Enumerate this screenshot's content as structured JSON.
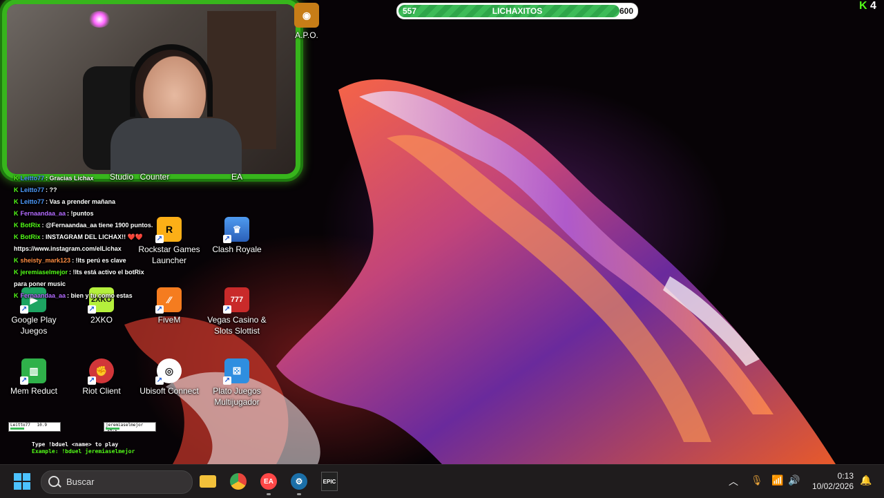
{
  "stream_overlay": {
    "subscriber_goal": {
      "current": "557",
      "label": "LICHAXITOS",
      "target": "600",
      "progress": 0.93
    },
    "viewer_badge": "4",
    "chat": [
      {
        "user": "Leitto77",
        "message": ": Gracias Lichax",
        "user_color": "#4e9bff"
      },
      {
        "user": "Leitto77",
        "message": ": ??",
        "user_color": "#4e9bff"
      },
      {
        "user": "Leitto77",
        "message": ": Vas a prender mañana",
        "user_color": "#4e9bff"
      },
      {
        "user": "Fernaandaa_aa",
        "message": ": !puntos",
        "user_color": "#b46bff"
      },
      {
        "user": "BotRix",
        "message": ": @Fernaandaa_aa tiene 1900 puntos.",
        "user_color": "#53fc18"
      },
      {
        "user": "BotRix",
        "message": ": INSTAGRAM DEL LICHAX!! ❤️❤️ https://www.instagram.com/elLichax",
        "user_color": "#53fc18"
      },
      {
        "user": "sheisty_mark123",
        "message": ": !lts perú es clave",
        "user_color": "#ff8c42"
      },
      {
        "user": "jeremiaselmejor",
        "message": ": !lts está activo el botRix para poner music",
        "user_color": "#53fc18"
      },
      {
        "user": "Fernaandaa_aa",
        "message": ": bien y tu como estas",
        "user_color": "#b46bff"
      }
    ],
    "duel_cards": [
      {
        "name": "Leitto77",
        "value": "10.9"
      },
      {
        "name": "jeremiaselmejor",
        "value": "14.1"
      }
    ],
    "duel_help": [
      "Type !bduel <name> to play",
      "Example: !bduel jeremiaselmejor"
    ]
  },
  "desktop_icons": [
    {
      "label": "A.P.O.",
      "icon": "app-icon",
      "color": "#c77d17"
    },
    {
      "label": "Studio",
      "icon": "studio-icon",
      "color": "#333"
    },
    {
      "label": "Counter",
      "icon": "counter-strike-icon",
      "color": "#333"
    },
    {
      "label": "EA",
      "icon": "ea-icon",
      "color": "#ff4747"
    },
    {
      "label": "Rockstar Games Launcher",
      "icon": "rockstar-icon",
      "color": "#fcaf17"
    },
    {
      "label": "Clash Royale",
      "icon": "clash-royale-icon",
      "color": "#3b7ddd"
    },
    {
      "label": "Google Play Juegos",
      "icon": "google-play-games-icon",
      "color": "#1da462"
    },
    {
      "label": "2XKO",
      "icon": "2xko-icon",
      "color": "#b5f03c"
    },
    {
      "label": "FiveM",
      "icon": "fivem-icon",
      "color": "#f57c1f"
    },
    {
      "label": "Vegas Casino & Slots Slottist",
      "icon": "vegas-casino-icon",
      "color": "#c92a2a"
    },
    {
      "label": "Mem Reduct",
      "icon": "mem-reduct-icon",
      "color": "#2fb14a"
    },
    {
      "label": "Riot Client",
      "icon": "riot-client-icon",
      "color": "#d13639"
    },
    {
      "label": "Ubisoft Connect",
      "icon": "ubisoft-connect-icon",
      "color": "#ffffff"
    },
    {
      "label": "Plato Juegos Multijugador",
      "icon": "plato-icon",
      "color": "#2f8ee0"
    }
  ],
  "taskbar": {
    "search_text": "Buscar",
    "pinned": [
      {
        "name": "file-explorer",
        "icon": "folder-icon",
        "color": "#f3c13a"
      },
      {
        "name": "chrome",
        "icon": "chrome-icon",
        "color": "#e8453c"
      },
      {
        "name": "ea-app",
        "icon": "ea-icon",
        "color": "#ff4747"
      },
      {
        "name": "steam",
        "icon": "steam-icon",
        "color": "#1b6fa8"
      },
      {
        "name": "epic-games",
        "icon": "epic-games-icon",
        "color": "#222"
      }
    ],
    "epic_label": "EPIC",
    "ea_label": "EA",
    "clock_time": "0:13",
    "clock_date": "10/02/2026"
  }
}
